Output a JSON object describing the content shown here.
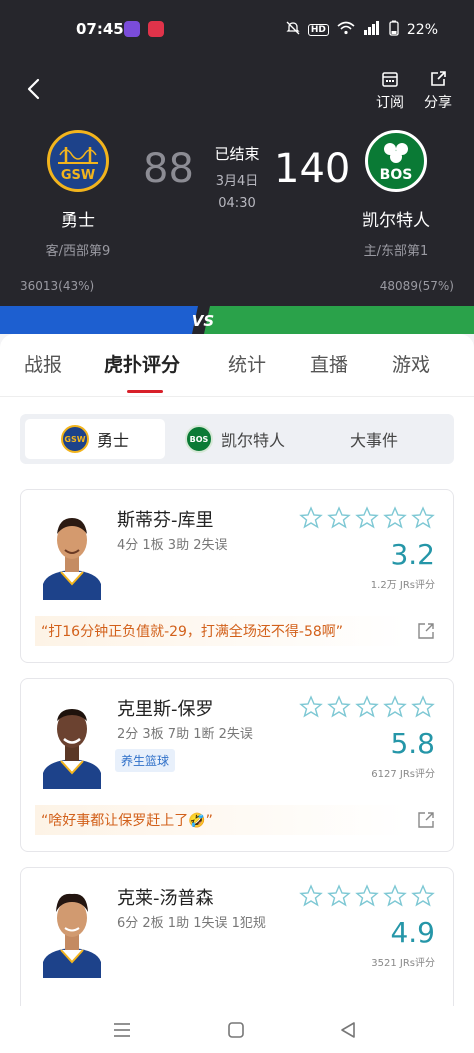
{
  "status_bar": {
    "time": "07:45",
    "battery": "22%",
    "hd": "HD",
    "network": "4G"
  },
  "header": {
    "actions": [
      {
        "label": "订阅",
        "icon": "calendar-icon"
      },
      {
        "label": "分享",
        "icon": "share-icon"
      }
    ],
    "home": {
      "name": "勇士",
      "abbr": "GSW",
      "score": "88",
      "rank": "客/西部第9",
      "support": "36013(43%)",
      "color": "#1d5fd0"
    },
    "away": {
      "name": "凯尔特人",
      "abbr": "BOS",
      "score": "140",
      "rank": "主/东部第1",
      "support": "48089(57%)",
      "color": "#2aa24a"
    },
    "status": "已结束",
    "date": "3月4日",
    "time": "04:30",
    "vs_label": "VS"
  },
  "tabs": [
    {
      "label": "战报"
    },
    {
      "label": "虎扑评分",
      "active": true
    },
    {
      "label": "统计"
    },
    {
      "label": "直播"
    },
    {
      "label": "游戏"
    }
  ],
  "subtabs": [
    {
      "label": "勇士",
      "logo": "GSW",
      "active": true
    },
    {
      "label": "凯尔特人",
      "logo": "BOS"
    },
    {
      "label": "大事件"
    }
  ],
  "players": [
    {
      "name": "斯蒂芬-库里",
      "stats": "4分 1板 3助 2失误",
      "rating": "3.2",
      "count": "1.2万 JRs评分",
      "comment": "“打16分钟正负值就-29，打满全场还不得-58啊”"
    },
    {
      "name": "克里斯-保罗",
      "stats": "2分 3板 7助 1断 2失误",
      "tag": "养生篮球",
      "rating": "5.8",
      "count": "6127 JRs评分",
      "comment": "“啥好事都让保罗赶上了🤣”"
    },
    {
      "name": "克莱-汤普森",
      "stats": "6分 2板 1助 1失误 1犯规",
      "rating": "4.9",
      "count": "3521 JRs评分"
    }
  ],
  "colors": {
    "accent_red": "#d8202a",
    "rating_teal": "#2596a8",
    "warriors_gold": "#f2b41d",
    "celtics_green": "#2aa24a"
  }
}
